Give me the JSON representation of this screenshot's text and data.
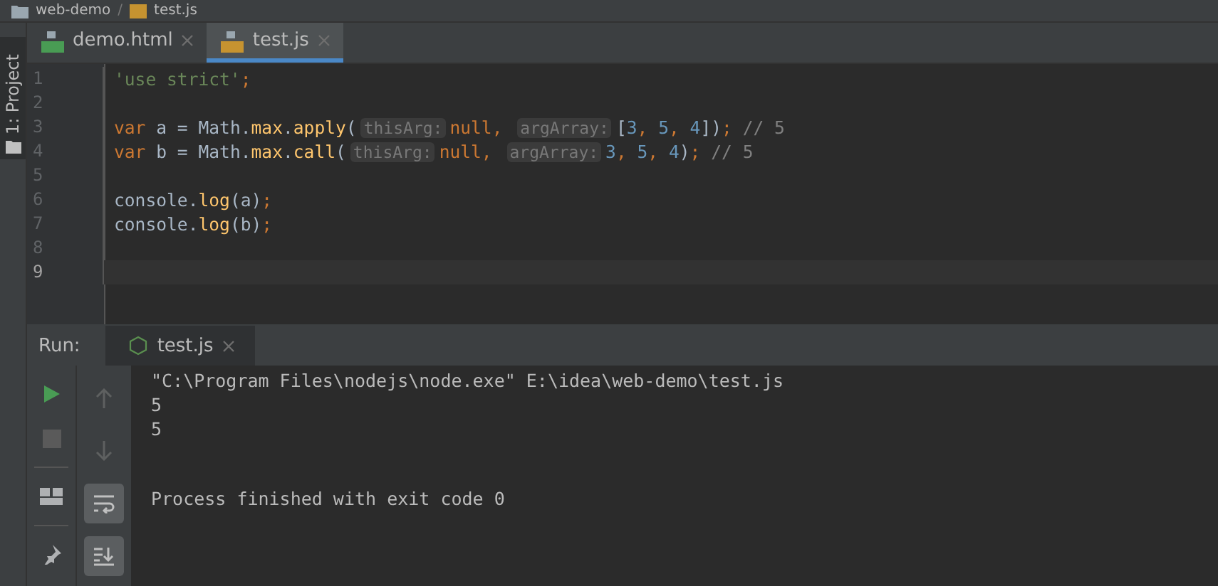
{
  "breadcrumb_separator": "/",
  "breadcrumb": [
    {
      "label": "web-demo",
      "kind": "folder"
    },
    {
      "label": "test.js",
      "kind": "js"
    }
  ],
  "side_tool": {
    "label": "1: Project"
  },
  "tabs": [
    {
      "label": "demo.html",
      "kind": "html",
      "selected": false
    },
    {
      "label": "test.js",
      "kind": "js",
      "selected": true
    }
  ],
  "editor": {
    "lines": [
      {
        "number": "1",
        "current": false,
        "tokens": [
          {
            "kind": "string",
            "text": "'use strict'"
          },
          {
            "kind": "keyword",
            "text": ";"
          }
        ]
      },
      {
        "number": "2",
        "current": false
      },
      {
        "number": "3",
        "current": false,
        "tokens": [
          {
            "kind": "keyword",
            "text": "var "
          },
          {
            "kind": "plain",
            "text": "a = Math."
          },
          {
            "kind": "func",
            "text": "max"
          },
          {
            "kind": "plain",
            "text": "."
          },
          {
            "kind": "func",
            "text": "apply"
          },
          {
            "kind": "plain",
            "text": "("
          },
          {
            "kind": "hint",
            "text": "thisArg:"
          },
          {
            "kind": "keyword",
            "text": "null, "
          },
          {
            "kind": "hint",
            "text": "argArray:"
          },
          {
            "kind": "plain",
            "text": "["
          },
          {
            "kind": "number",
            "text": "3"
          },
          {
            "kind": "keyword",
            "text": ", "
          },
          {
            "kind": "number",
            "text": "5"
          },
          {
            "kind": "keyword",
            "text": ", "
          },
          {
            "kind": "number",
            "text": "4"
          },
          {
            "kind": "plain",
            "text": "])"
          },
          {
            "kind": "keyword",
            "text": "; "
          },
          {
            "kind": "comment",
            "text": "// 5"
          }
        ]
      },
      {
        "number": "4",
        "current": false,
        "tokens": [
          {
            "kind": "keyword",
            "text": "var "
          },
          {
            "kind": "plain",
            "text": "b = Math."
          },
          {
            "kind": "func",
            "text": "max"
          },
          {
            "kind": "plain",
            "text": "."
          },
          {
            "kind": "func",
            "text": "call"
          },
          {
            "kind": "plain",
            "text": "("
          },
          {
            "kind": "hint",
            "text": "thisArg:"
          },
          {
            "kind": "keyword",
            "text": "null, "
          },
          {
            "kind": "hint",
            "text": "argArray:"
          },
          {
            "kind": "number",
            "text": "3"
          },
          {
            "kind": "keyword",
            "text": ", "
          },
          {
            "kind": "number",
            "text": "5"
          },
          {
            "kind": "keyword",
            "text": ", "
          },
          {
            "kind": "number",
            "text": "4"
          },
          {
            "kind": "plain",
            "text": ")"
          },
          {
            "kind": "keyword",
            "text": "; "
          },
          {
            "kind": "comment",
            "text": "// 5"
          }
        ]
      },
      {
        "number": "5",
        "current": false
      },
      {
        "number": "6",
        "current": false,
        "tokens": [
          {
            "kind": "plain",
            "text": "console."
          },
          {
            "kind": "func",
            "text": "log"
          },
          {
            "kind": "plain",
            "text": "(a)"
          },
          {
            "kind": "keyword",
            "text": ";"
          }
        ]
      },
      {
        "number": "7",
        "current": false,
        "tokens": [
          {
            "kind": "plain",
            "text": "console."
          },
          {
            "kind": "func",
            "text": "log"
          },
          {
            "kind": "plain",
            "text": "(b)"
          },
          {
            "kind": "keyword",
            "text": ";"
          }
        ]
      },
      {
        "number": "8",
        "current": false
      },
      {
        "number": "9",
        "current": true
      }
    ]
  },
  "run_panel": {
    "label": "Run:",
    "tabs": [
      {
        "label": "test.js",
        "selected": true
      }
    ],
    "toolbar": [
      {
        "kind": "run",
        "disabled": false
      },
      {
        "kind": "stop",
        "disabled": true
      },
      {
        "kind": "layout",
        "disabled": false
      },
      {
        "kind": "pin",
        "disabled": false
      }
    ],
    "toolbar_2": [
      {
        "kind": "up",
        "on": false
      },
      {
        "kind": "down",
        "on": false
      },
      {
        "kind": "wrap",
        "on": true
      },
      {
        "kind": "scroll-end",
        "on": true
      }
    ],
    "output": [
      "\"C:\\Program Files\\nodejs\\node.exe\" E:\\idea\\web-demo\\test.js",
      "5",
      "5"
    ],
    "status": "Process finished with exit code 0"
  }
}
